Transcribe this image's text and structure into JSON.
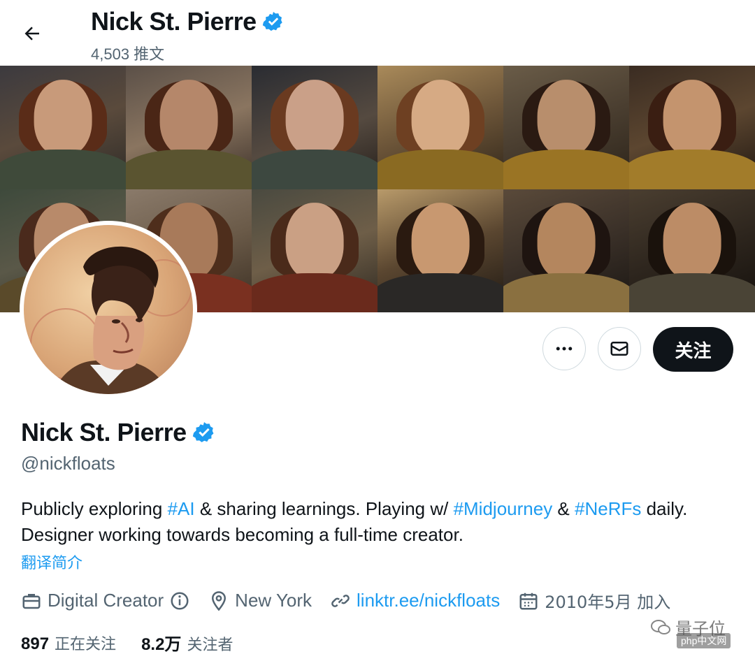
{
  "header": {
    "display_name": "Nick St. Pierre",
    "tweet_count": "4,503 推文"
  },
  "icons": {
    "back": "arrow-left-icon",
    "verified": "verified-badge-icon",
    "more": "more-horizontal-icon",
    "message": "envelope-icon",
    "briefcase": "briefcase-icon",
    "info": "info-circle-icon",
    "location": "location-pin-icon",
    "link": "link-icon",
    "calendar": "calendar-icon"
  },
  "actions": {
    "follow_label": "关注"
  },
  "profile": {
    "display_name": "Nick St. Pierre",
    "handle": "@nickfloats",
    "bio_part1": "Publicly exploring ",
    "bio_tag1": "#AI",
    "bio_part2": " & sharing learnings. Playing w/ ",
    "bio_tag2": "#Midjourney",
    "bio_part3": " & ",
    "bio_tag3": "#NeRFs",
    "bio_part4": " daily.",
    "bio_line2": "Designer working towards becoming a full-time creator.",
    "translate_label": "翻译简介",
    "category": "Digital Creator",
    "location": "New York",
    "website": "linktr.ee/nickfloats",
    "joined": "2010年5月 加入"
  },
  "stats": {
    "following_count": "897",
    "following_label": "正在关注",
    "followers_count": "8.2万",
    "followers_label": "关注者"
  },
  "watermark": {
    "brand": "量子位",
    "sub": "php中文网"
  },
  "colors": {
    "accent": "#1d9bf0",
    "text": "#0f1419",
    "secondary": "#536471",
    "follow_bg": "#0f1419"
  }
}
